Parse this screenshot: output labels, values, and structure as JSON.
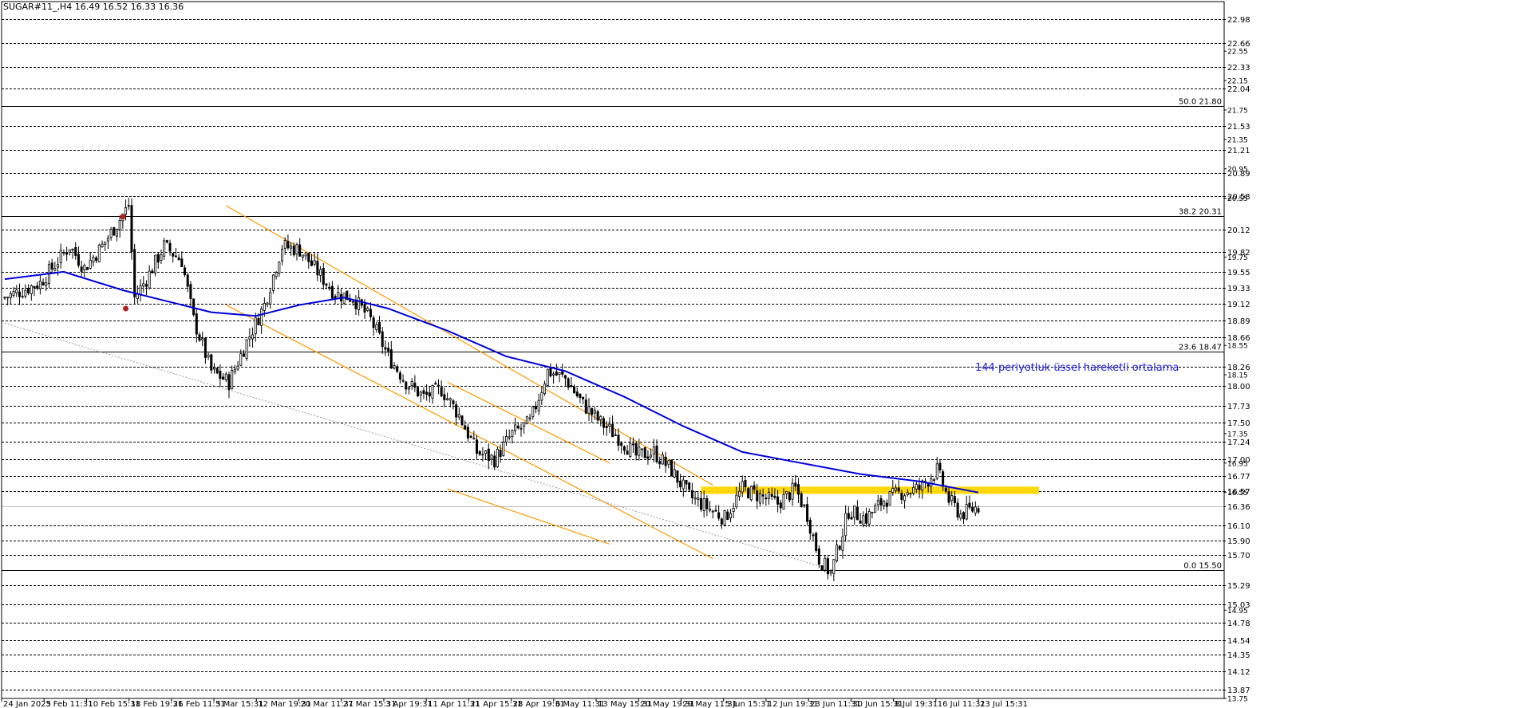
{
  "chart_data": {
    "type": "candlestick",
    "title": "SUGAR#11_,H4  16.49 16.52 16.33 16.36",
    "colors": {
      "background": "#ffffff",
      "candle": "#000000",
      "ema": "#0000dd",
      "channel": "#ff9900",
      "zone": "#ffd700",
      "fib": "#000000",
      "annotation": "#2222dd",
      "marker": "#b22222"
    },
    "grid": true,
    "y_axis": {
      "min": 13.75,
      "max": 23.05,
      "scale": "linear",
      "dashed_level_labels": [
        "22.98",
        "22.66",
        "22.33",
        "22.04",
        "21.53",
        "21.21",
        "20.89",
        "20.58",
        "20.12",
        "19.82",
        "19.55",
        "19.33",
        "19.12",
        "18.89",
        "18.66",
        "18.26",
        "18.00",
        "17.73",
        "17.50",
        "17.24",
        "17.00",
        "16.77",
        "16.57",
        "16.36",
        "16.10",
        "15.90",
        "15.70",
        "15.29",
        "15.03",
        "14.78",
        "14.54",
        "14.35",
        "14.12",
        "13.87"
      ],
      "minor_tick_labels": [
        "22.55",
        "22.15",
        "21.75",
        "21.35",
        "20.95",
        "20.55",
        "19.75",
        "18.55",
        "18.15",
        "17.35",
        "16.95",
        "16.55",
        "14.95",
        "13.75"
      ]
    },
    "x_axis": {
      "tick_labels": [
        "24 Jan 2025",
        "3 Feb 11:31",
        "10 Feb 15:31",
        "18 Feb 19:31",
        "26 Feb 11:31",
        "5 Mar 15:31",
        "12 Mar 19:31",
        "20 Mar 11:31",
        "27 Mar 15:31",
        "3 Apr 19:31",
        "11 Apr 11:31",
        "21 Apr 15:31",
        "28 Apr 19:31",
        "6 May 11:31",
        "13 May 15:31",
        "20 May 19:31",
        "29 May 11:31",
        "5 Jun 15:31",
        "12 Jun 19:31",
        "23 Jun 11:31",
        "30 Jun 15:31",
        "8 Jul 19:31",
        "16 Jul 11:31",
        "23 Jul 15:31"
      ]
    },
    "fib_levels": [
      {
        "label": "50.0 21.80",
        "value": 21.8
      },
      {
        "label": "38.2 20.31",
        "value": 20.31
      },
      {
        "label": "23.6 18.47",
        "value": 18.47
      },
      {
        "label": "0.0 15.50",
        "value": 15.5
      }
    ],
    "last_price_line": 16.36,
    "support_zone": {
      "low": 16.53,
      "high": 16.63
    },
    "annotation": "144 periyotluk üssel hareketli ortalama",
    "close_path": [
      [
        0,
        19.2
      ],
      [
        12,
        19.4
      ],
      [
        22,
        19.9
      ],
      [
        27,
        19.6
      ],
      [
        33,
        19.9
      ],
      [
        38,
        20.2
      ],
      [
        42,
        20.45
      ],
      [
        44,
        19.2
      ],
      [
        48,
        19.45
      ],
      [
        54,
        19.9
      ],
      [
        60,
        19.7
      ],
      [
        64,
        18.9
      ],
      [
        70,
        18.2
      ],
      [
        76,
        18.05
      ],
      [
        82,
        18.6
      ],
      [
        88,
        19.1
      ],
      [
        94,
        19.9
      ],
      [
        100,
        19.85
      ],
      [
        106,
        19.55
      ],
      [
        112,
        19.25
      ],
      [
        118,
        19.2
      ],
      [
        124,
        18.9
      ],
      [
        130,
        18.4
      ],
      [
        136,
        18.05
      ],
      [
        142,
        17.85
      ],
      [
        148,
        17.95
      ],
      [
        154,
        17.6
      ],
      [
        160,
        17.1
      ],
      [
        166,
        17.0
      ],
      [
        172,
        17.35
      ],
      [
        178,
        17.5
      ],
      [
        184,
        18.2
      ],
      [
        190,
        18.1
      ],
      [
        196,
        17.75
      ],
      [
        202,
        17.5
      ],
      [
        208,
        17.3
      ],
      [
        214,
        17.05
      ],
      [
        220,
        17.1
      ],
      [
        226,
        16.85
      ],
      [
        232,
        16.5
      ],
      [
        238,
        16.35
      ],
      [
        244,
        16.2
      ],
      [
        250,
        16.6
      ],
      [
        256,
        16.5
      ],
      [
        262,
        16.4
      ],
      [
        268,
        16.6
      ],
      [
        272,
        16.25
      ],
      [
        276,
        15.65
      ],
      [
        280,
        15.45
      ],
      [
        286,
        16.3
      ],
      [
        292,
        16.2
      ],
      [
        298,
        16.45
      ],
      [
        304,
        16.55
      ],
      [
        310,
        16.6
      ],
      [
        316,
        16.85
      ],
      [
        320,
        16.45
      ],
      [
        324,
        16.25
      ],
      [
        330,
        16.36
      ]
    ],
    "ema_path": [
      [
        0,
        19.45
      ],
      [
        20,
        19.55
      ],
      [
        40,
        19.3
      ],
      [
        55,
        19.15
      ],
      [
        70,
        19.0
      ],
      [
        85,
        18.95
      ],
      [
        100,
        19.1
      ],
      [
        115,
        19.2
      ],
      [
        130,
        19.05
      ],
      [
        150,
        18.75
      ],
      [
        170,
        18.4
      ],
      [
        190,
        18.2
      ],
      [
        210,
        17.85
      ],
      [
        230,
        17.45
      ],
      [
        250,
        17.1
      ],
      [
        270,
        16.95
      ],
      [
        290,
        16.8
      ],
      [
        310,
        16.7
      ],
      [
        330,
        16.55
      ]
    ],
    "channels": [
      {
        "upper": [
          [
            75,
            20.45
          ],
          [
            240,
            16.65
          ]
        ],
        "lower": [
          [
            75,
            19.1
          ],
          [
            240,
            15.65
          ]
        ]
      },
      {
        "upper": [
          [
            150,
            18.05
          ],
          [
            205,
            16.95
          ]
        ],
        "lower": [
          [
            150,
            16.6
          ],
          [
            205,
            15.85
          ]
        ]
      }
    ],
    "markers": [
      [
        40,
        20.3
      ],
      [
        41,
        19.05
      ]
    ]
  }
}
